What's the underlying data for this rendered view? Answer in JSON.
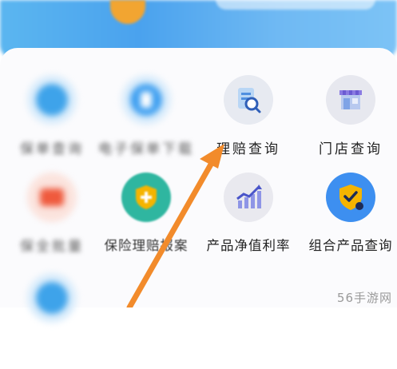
{
  "grid": {
    "row1": [
      {
        "label": "保单查询",
        "icon": "blue-circle-icon",
        "color": "#3ea3ea"
      },
      {
        "label": "电子保单下载",
        "icon": "document-icon",
        "color": "#3a9df0"
      },
      {
        "label": "理赔查询",
        "icon": "claim-search-icon",
        "color": "#3e8be6"
      },
      {
        "label": "门店查询",
        "icon": "store-icon",
        "color": "#6b5bd2"
      }
    ],
    "row2": [
      {
        "label": "保全批量",
        "icon": "red-card-icon",
        "color": "#ef5a3d"
      },
      {
        "label": "保险理赔报案",
        "icon": "shield-plus-icon",
        "color": "#f5b400"
      },
      {
        "label": "产品净值利率",
        "icon": "trend-chart-icon",
        "color": "#5a67d8"
      },
      {
        "label": "组合产品查询",
        "icon": "shield-check-icon",
        "color": "#f5b400"
      }
    ]
  },
  "watermark": "56手游网"
}
